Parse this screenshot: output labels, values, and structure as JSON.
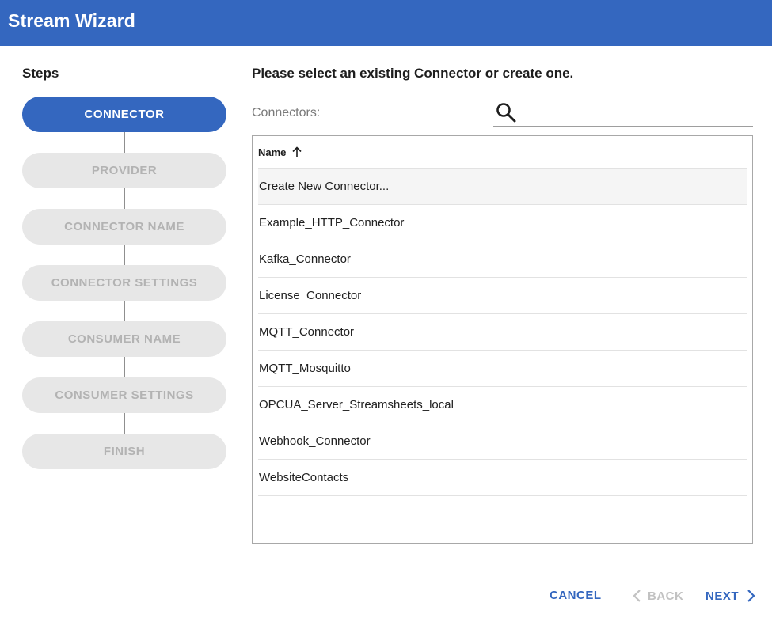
{
  "window": {
    "title": "Stream Wizard"
  },
  "steps": {
    "heading": "Steps",
    "items": [
      {
        "label": "CONNECTOR",
        "active": true
      },
      {
        "label": "PROVIDER",
        "active": false
      },
      {
        "label": "CONNECTOR NAME",
        "active": false
      },
      {
        "label": "CONNECTOR SETTINGS",
        "active": false
      },
      {
        "label": "CONSUMER NAME",
        "active": false
      },
      {
        "label": "CONSUMER SETTINGS",
        "active": false
      },
      {
        "label": "FINISH",
        "active": false
      }
    ]
  },
  "main": {
    "prompt": "Please select an existing Connector or create one.",
    "connectors_label": "Connectors:",
    "search": {
      "value": "",
      "icon": "search-icon"
    },
    "table": {
      "column": "Name",
      "sort": "ascending",
      "rows": [
        "Create New Connector...",
        "Example_HTTP_Connector",
        "Kafka_Connector",
        "License_Connector",
        "MQTT_Connector",
        "MQTT_Mosquitto",
        "OPCUA_Server_Streamsheets_local",
        "Webhook_Connector",
        "WebsiteContacts"
      ],
      "highlighted_row": 0
    }
  },
  "footer": {
    "cancel_label": "CANCEL",
    "back_label": "BACK",
    "next_label": "NEXT",
    "back_enabled": false
  },
  "colors": {
    "accent": "#3467bf",
    "step_inactive_bg": "#e7e7e7",
    "step_inactive_text": "#b3b3b3",
    "disabled_text": "#c2c2c2"
  }
}
